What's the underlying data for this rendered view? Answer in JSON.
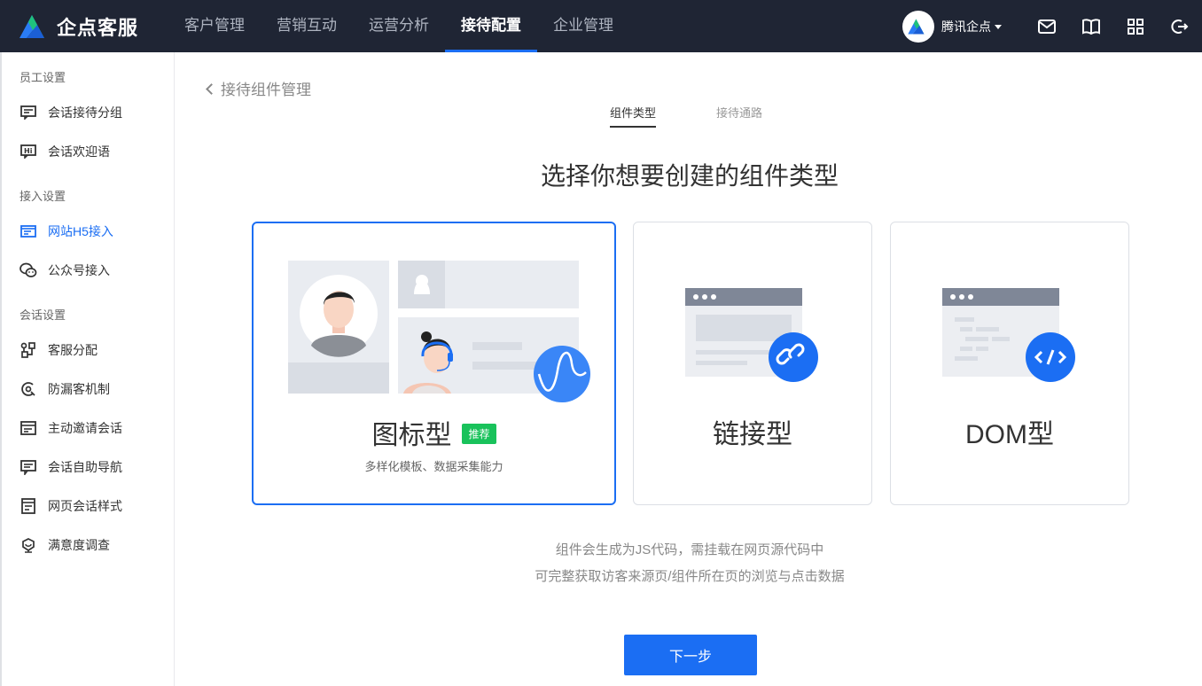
{
  "brand": {
    "name": "企点客服"
  },
  "nav": {
    "items": [
      "客户管理",
      "营销互动",
      "运营分析",
      "接待配置",
      "企业管理"
    ],
    "active_index": 3
  },
  "account": {
    "name": "腾讯企点"
  },
  "top_icons": [
    "mail-icon",
    "book-icon",
    "apps-icon",
    "logout-icon"
  ],
  "sidebar": {
    "groups": [
      {
        "title": "员工设置",
        "items": [
          {
            "label": "会话接待分组",
            "icon": "chat-group-icon"
          },
          {
            "label": "会话欢迎语",
            "icon": "greeting-icon"
          }
        ]
      },
      {
        "title": "接入设置",
        "items": [
          {
            "label": "网站H5接入",
            "icon": "web-icon"
          },
          {
            "label": "公众号接入",
            "icon": "wechat-icon"
          }
        ]
      },
      {
        "title": "会话设置",
        "items": [
          {
            "label": "客服分配",
            "icon": "assign-icon"
          },
          {
            "label": "防漏客机制",
            "icon": "guard-icon"
          },
          {
            "label": "主动邀请会话",
            "icon": "invite-icon"
          },
          {
            "label": "会话自助导航",
            "icon": "navigation-icon"
          },
          {
            "label": "网页会话样式",
            "icon": "style-icon"
          },
          {
            "label": "满意度调查",
            "icon": "survey-icon"
          }
        ]
      }
    ],
    "active_label": "网站H5接入"
  },
  "main": {
    "back_label": "接待组件管理",
    "steps": [
      "组件类型",
      "接待通路"
    ],
    "active_step": 0,
    "heading": "选择你想要创建的组件类型",
    "cards": [
      {
        "title": "图标型",
        "tag": "推荐",
        "desc": "多样化模板、数据采集能力",
        "selected": true
      },
      {
        "title": "链接型",
        "selected": false
      },
      {
        "title": "DOM型",
        "selected": false
      }
    ],
    "note_line1": "组件会生成为JS代码，需挂载在网页源代码中",
    "note_line2": "可完整获取访客来源页/组件所在页的浏览与点击数据",
    "next_label": "下一步"
  },
  "colors": {
    "primary": "#1b6ef3",
    "topbar": "#1f2534",
    "tag_green": "#19c25b"
  }
}
